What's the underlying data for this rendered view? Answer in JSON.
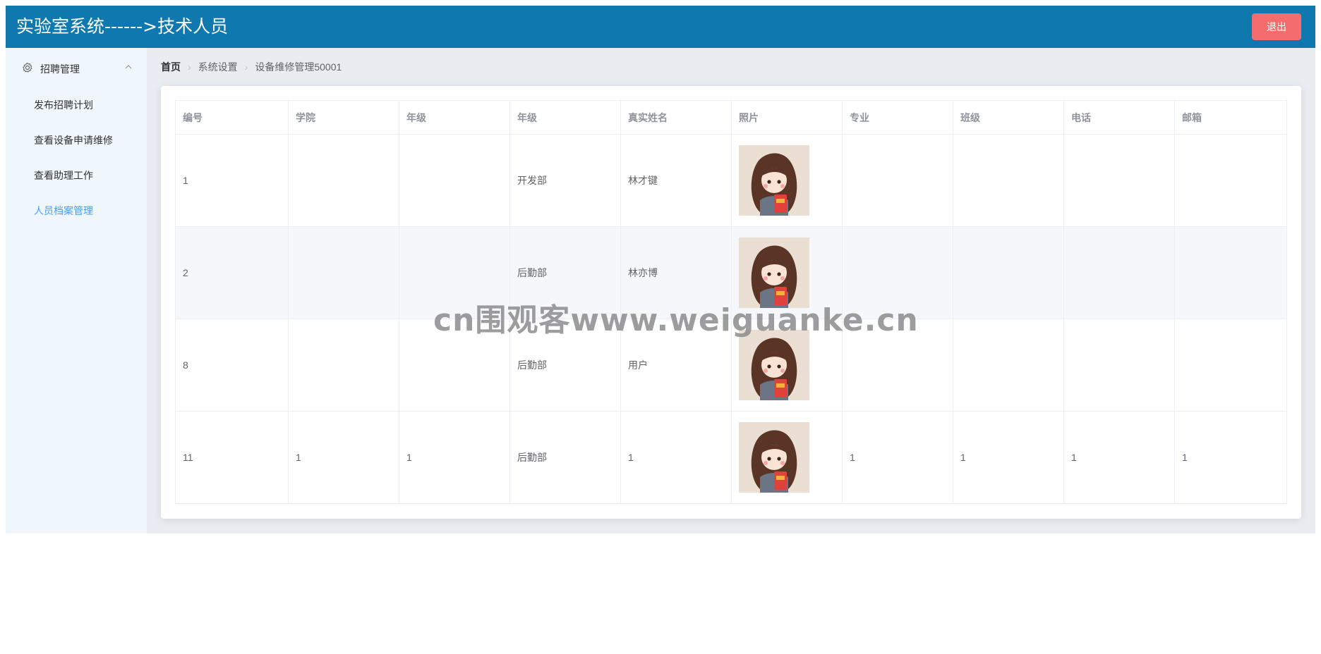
{
  "header": {
    "title": "实验室系统------>技术人员",
    "logout_label": "退出",
    "bg_color": "#0f78ae"
  },
  "sidebar": {
    "group_label": "招聘管理",
    "group_icon": "gear-icon",
    "items": [
      {
        "label": "发布招聘计划",
        "active": false
      },
      {
        "label": "查看设备申请维修",
        "active": false
      },
      {
        "label": "查看助理工作",
        "active": false
      },
      {
        "label": "人员档案管理",
        "active": true
      }
    ]
  },
  "breadcrumb": [
    "首页",
    "系统设置",
    "设备维修管理50001"
  ],
  "table": {
    "columns": [
      "编号",
      "学院",
      "年级",
      "年级",
      "真实姓名",
      "照片",
      "专业",
      "班级",
      "电话",
      "邮箱"
    ],
    "rows": [
      [
        "1",
        "",
        "",
        "开发部",
        "林才键",
        "",
        "",
        "",
        "",
        ""
      ],
      [
        "2",
        "",
        "",
        "后勤部",
        "林亦博",
        "",
        "",
        "",
        "",
        ""
      ],
      [
        "8",
        "",
        "",
        "后勤部",
        "用户",
        "",
        "",
        "",
        "",
        ""
      ],
      [
        "11",
        "1",
        "1",
        "后勤部",
        "1",
        "",
        "1",
        "1",
        "1",
        "1"
      ]
    ]
  },
  "watermark": "cn围观客www.weiguanke.cn",
  "colors": {
    "accent": "#409eff",
    "danger": "#f56c6c"
  }
}
